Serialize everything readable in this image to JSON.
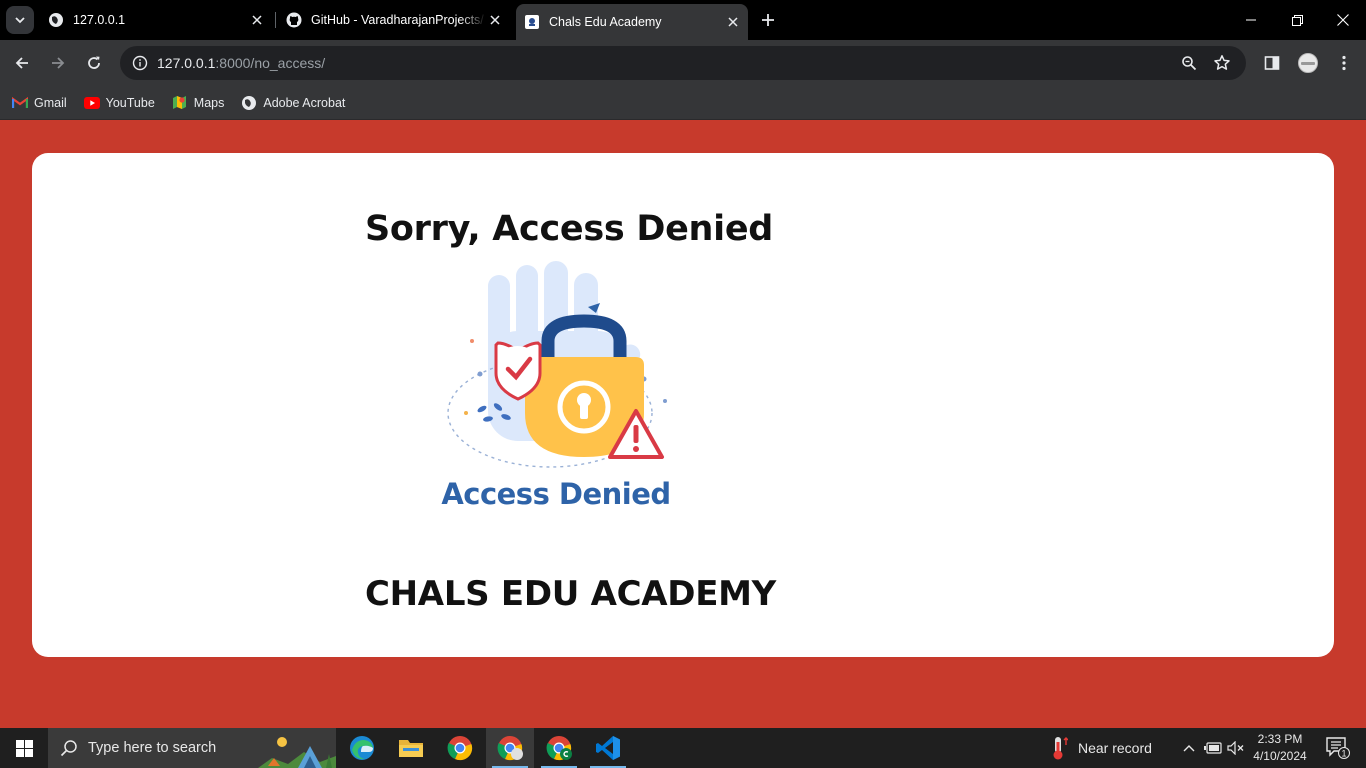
{
  "browser": {
    "tabs": [
      {
        "title": "127.0.0.1",
        "icon": "globe-icon",
        "active": false
      },
      {
        "title": "GitHub - VaradharajanProjects/",
        "icon": "github-icon",
        "active": false
      },
      {
        "title": "Chals Edu Academy",
        "icon": "site-favicon",
        "active": true
      }
    ],
    "address": {
      "host": "127.0.0.1",
      "path": ":8000/no_access/"
    },
    "bookmarks": [
      {
        "label": "Gmail",
        "icon": "gmail-icon"
      },
      {
        "label": "YouTube",
        "icon": "youtube-icon"
      },
      {
        "label": "Maps",
        "icon": "maps-icon"
      },
      {
        "label": "Adobe Acrobat",
        "icon": "globe-icon"
      }
    ]
  },
  "page": {
    "heading": "Sorry, Access Denied",
    "image_caption": "Access Denied",
    "footer_title": "CHALS EDU ACADEMY",
    "colors": {
      "background": "#c73a2c",
      "card": "#ffffff",
      "caption": "#2e63a8",
      "lock": "#ffc24a"
    }
  },
  "taskbar": {
    "search_placeholder": "Type here to search",
    "weather": "Near record",
    "time": "2:33 PM",
    "date": "4/10/2024",
    "notification_count": "1"
  }
}
